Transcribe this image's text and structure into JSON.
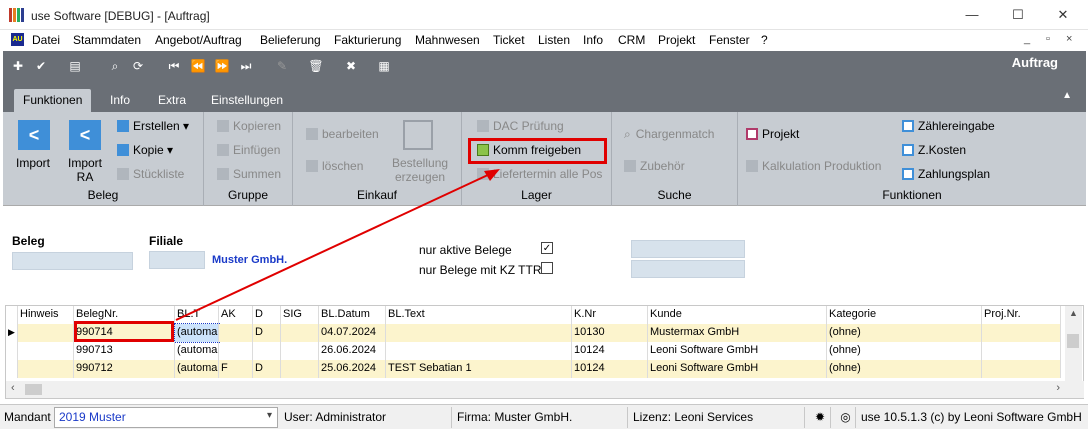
{
  "window": {
    "title": "use Software [DEBUG] - [Auftrag]",
    "minimize_glyph": "—",
    "maximize_glyph": "☐",
    "close_glyph": "✕"
  },
  "menu": {
    "mdi_icon_text": "AU",
    "items": [
      "Datei",
      "Stammdaten",
      "Angebot/Auftrag",
      "Belieferung",
      "Fakturierung",
      "Mahnwesen",
      "Ticket",
      "Listen",
      "Info",
      "CRM",
      "Projekt",
      "Fenster",
      "?"
    ],
    "mdi_buttons": [
      "_",
      "▫",
      "×"
    ]
  },
  "toolbar": {
    "section_title": "Auftrag",
    "icons": [
      "add-icon",
      "check-icon",
      "print-icon",
      "search-icon",
      "refresh-icon",
      "first-icon",
      "prev-icon",
      "next-icon",
      "last-icon",
      "edit-icon",
      "delete-icon",
      "close-icon",
      "grid-icon"
    ]
  },
  "tabs": [
    "Funktionen",
    "Info",
    "Extra",
    "Einstellungen"
  ],
  "ribbon": {
    "beleg": {
      "label": "Beleg",
      "import": "Import",
      "import_ra": "Import\nRA",
      "erstellen": "Erstellen",
      "kopie": "Kopie",
      "stueckliste": "Stückliste"
    },
    "gruppe": {
      "label": "Gruppe",
      "kopieren": "Kopieren",
      "einfuegen": "Einfügen",
      "summen": "Summen"
    },
    "einkauf": {
      "label": "Einkauf",
      "bearbeiten": "bearbeiten",
      "loeschen": "löschen",
      "bestellung": "Bestellung\nerzeugen"
    },
    "lager": {
      "label": "Lager",
      "dac": "DAC Prüfung",
      "komm": "Komm freigeben",
      "liefertermin": "Liefertermin alle Pos"
    },
    "suche": {
      "label": "Suche",
      "chargenmatch": "Chargenmatch",
      "zubehoer": "Zubehör"
    },
    "funktionen": {
      "label": "Funktionen",
      "projekt": "Projekt",
      "kalkulation": "Kalkulation Produktion",
      "zaehlereingabe": "Zählereingabe",
      "zkosten": "Z.Kosten",
      "zahlungsplan": "Zahlungsplan"
    }
  },
  "filter": {
    "beleg_label": "Beleg",
    "filiale_label": "Filiale",
    "filiale_name": "Muster GmbH.",
    "nur_aktive_label": "nur aktive Belege",
    "nur_aktive_checked": "✓",
    "nur_kz_label": "nur Belege mit KZ TTR",
    "nur_kz_checked": ""
  },
  "grid": {
    "columns": [
      "Hinweis",
      "BelegNr.",
      "BL.T",
      "AK",
      "D",
      "SIG",
      "BL.Datum",
      "BL.Text",
      "K.Nr",
      "Kunde",
      "Kategorie",
      "Proj.Nr."
    ],
    "rows": [
      [
        "",
        "990714",
        "(automa",
        "",
        "D",
        "",
        "04.07.2024",
        "",
        "10130",
        "Mustermax GmbH",
        "(ohne)",
        ""
      ],
      [
        "",
        "990713",
        "(automa",
        "",
        "",
        "",
        "26.06.2024",
        "",
        "10124",
        "Leoni Software GmbH",
        "(ohne)",
        ""
      ],
      [
        "",
        "990712",
        "(automa",
        "F",
        "D",
        "",
        "25.06.2024",
        "TEST Sebatian 1",
        "10124",
        "Leoni Software GmbH",
        "(ohne)",
        ""
      ]
    ]
  },
  "status": {
    "mandant_label": "Mandant",
    "mandant_value": "2019 Muster",
    "user": "User: Administrator",
    "firma": "Firma: Muster GmbH.",
    "lizenz": "Lizenz: Leoni Services",
    "version": "use 10.5.1.3 (c) by Leoni Software GmbH"
  }
}
